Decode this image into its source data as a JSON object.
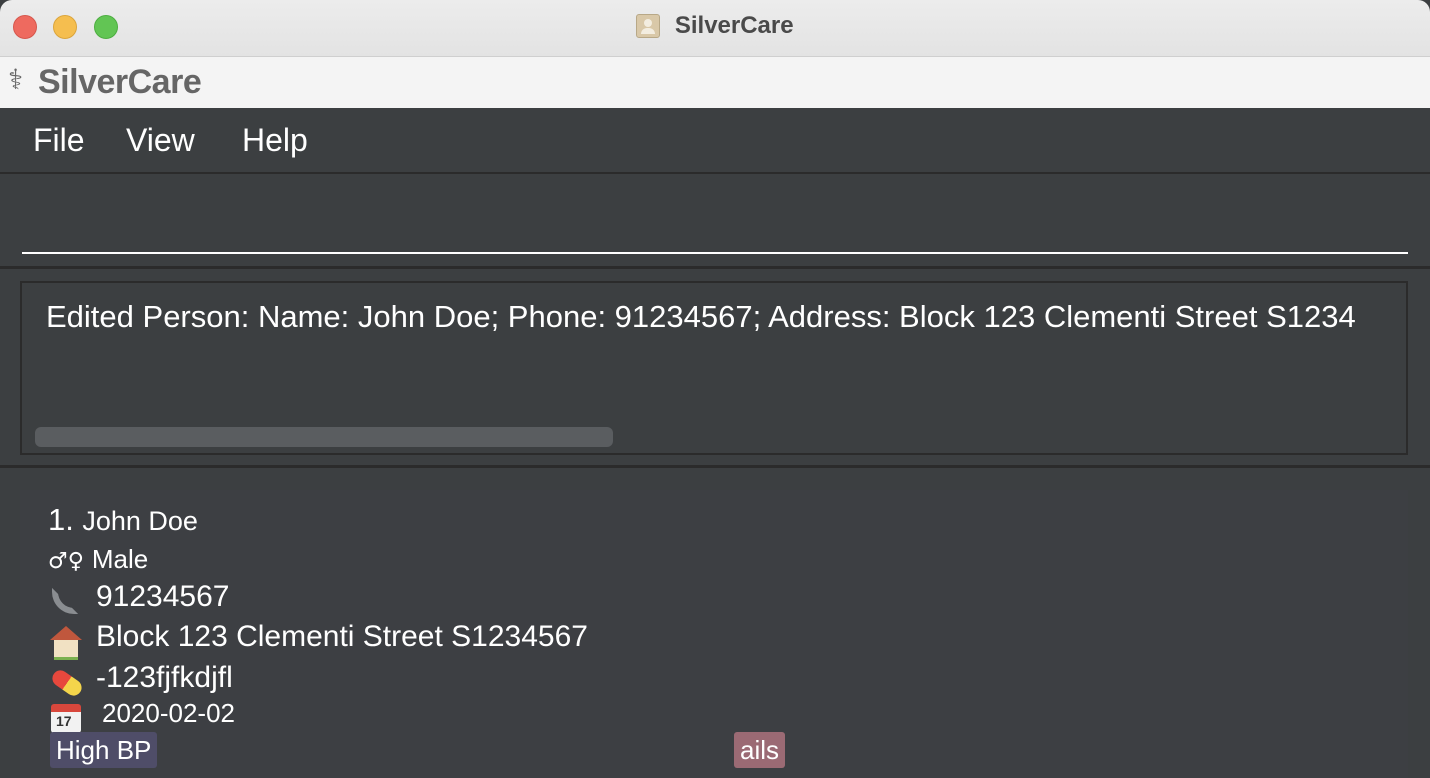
{
  "window": {
    "title": "SilverCare",
    "controls": [
      "close",
      "minimize",
      "zoom"
    ]
  },
  "app_header": {
    "icon": "caduceus-icon",
    "name": "SilverCare"
  },
  "menu": {
    "items": [
      "File",
      "View",
      "Help"
    ]
  },
  "command_box": {
    "value": "",
    "placeholder": ""
  },
  "result_display": {
    "text": "Edited Person: Name: John Doe; Phone: 91234567; Address: Block 123 Clementi Street S1234"
  },
  "persons": [
    {
      "index": "1.",
      "name": "John Doe",
      "gender_symbol": "♂♀",
      "gender": "Male",
      "phone": "91234567",
      "address": "Block 123 Clementi Street S1234567",
      "medication": "-123fjfkdjfl",
      "date": "2020-02-02",
      "tags": [
        {
          "label": "High BP",
          "color": "#4f4d68"
        },
        {
          "label": "ails",
          "color": "#9b6a74"
        }
      ]
    }
  ],
  "colors": {
    "background": "#3c3f41",
    "header_bg": "#f4f4f4",
    "app_name": "#666666"
  }
}
